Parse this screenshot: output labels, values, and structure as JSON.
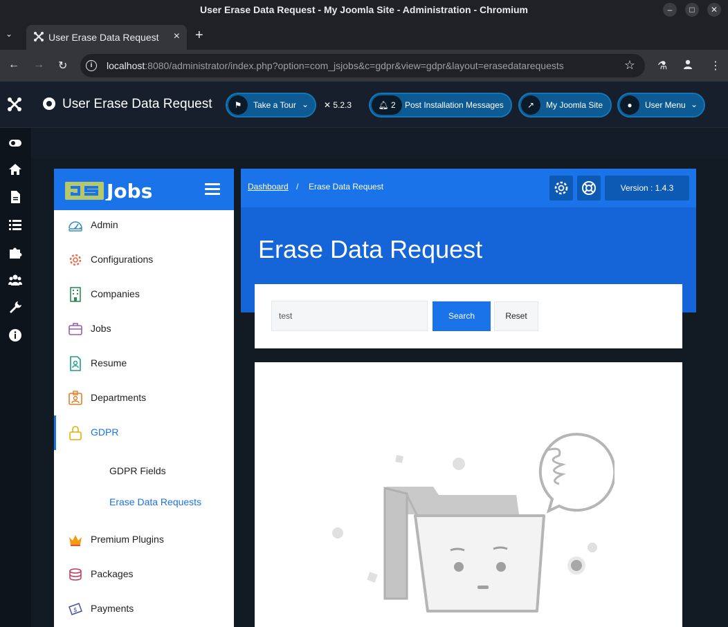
{
  "window": {
    "title": "User Erase Data Request - My Joomla Site - Administration - Chromium"
  },
  "browser": {
    "tab_title": "User Erase Data Request",
    "url_host": "localhost",
    "url_rest": ":8080/administrator/index.php?option=com_jsjobs&c=gdpr&view=gdpr&layout=erasedatarequests"
  },
  "joomla_header": {
    "title": "User Erase Data Request",
    "take_tour": "Take a Tour",
    "version": "5.2.3",
    "notif_count": "2",
    "post_install": "Post Installation Messages",
    "site": "My Joomla Site",
    "user_menu": "User Menu"
  },
  "sidebar": {
    "logo_text": "Jobs",
    "items": [
      {
        "label": "Admin",
        "icon": "dashboard-icon"
      },
      {
        "label": "Configurations",
        "icon": "gear-icon"
      },
      {
        "label": "Companies",
        "icon": "building-icon"
      },
      {
        "label": "Jobs",
        "icon": "briefcase-icon"
      },
      {
        "label": "Resume",
        "icon": "resume-icon"
      },
      {
        "label": "Departments",
        "icon": "department-icon"
      },
      {
        "label": "GDPR",
        "icon": "lock-icon"
      },
      {
        "label": "Premium Plugins",
        "icon": "crown-icon"
      },
      {
        "label": "Packages",
        "icon": "packages-icon"
      },
      {
        "label": "Payments",
        "icon": "payments-icon"
      }
    ],
    "sub_items": [
      {
        "label": "GDPR Fields"
      },
      {
        "label": "Erase Data Requests"
      }
    ]
  },
  "topbar": {
    "crumb_dashboard": "Dashboard",
    "crumb_sep": "/",
    "crumb_current": "Erase Data Request",
    "version": "Version : 1.4.3"
  },
  "main": {
    "title": "Erase Data Request",
    "search_value": "test",
    "search_btn": "Search",
    "reset_btn": "Reset"
  },
  "colors": {
    "accent": "#1a73e8",
    "joomla_header": "#161f2b",
    "pill": "#0d5b92"
  }
}
